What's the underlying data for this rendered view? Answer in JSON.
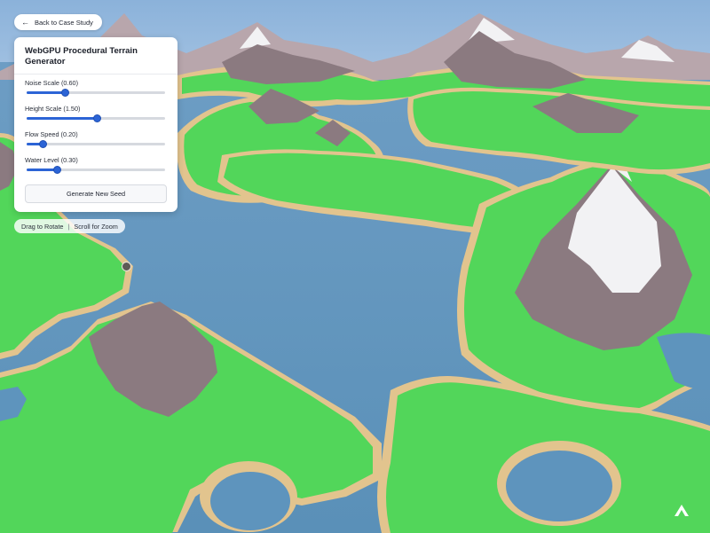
{
  "header": {
    "back_label": "Back to Case Study",
    "back_icon": "arrow-left-icon"
  },
  "panel": {
    "title": "WebGPU Procedural Terrain Generator",
    "controls": [
      {
        "label": "Noise Scale (0.60)",
        "fraction": 0.28
      },
      {
        "label": "Height Scale (1.50)",
        "fraction": 0.51
      },
      {
        "label": "Flow Speed (0.20)",
        "fraction": 0.12
      },
      {
        "label": "Water Level (0.30)",
        "fraction": 0.22
      }
    ],
    "generate_label": "Generate New Seed"
  },
  "hint": {
    "left": "Drag to Rotate",
    "separator": "|",
    "right": "Scroll for Zoom"
  },
  "colors": {
    "sky": "#8fb4da",
    "water": "#5e94bd",
    "grass": "#52d65a",
    "sand": "#e2c48e",
    "rock": "#8b7a80",
    "snow": "#f2f2f4",
    "accent": "#2c64d6"
  }
}
